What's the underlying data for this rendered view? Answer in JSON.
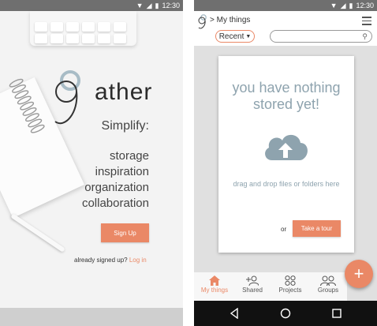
{
  "status_bar": {
    "time": "12:30"
  },
  "splash": {
    "logo_text": "ather",
    "tagline": "Simplify:",
    "features": [
      "storage",
      "inspiration",
      "organization",
      "collaboration"
    ],
    "signup_label": "Sign Up",
    "already_text": "already signed up?",
    "login_label": "Log in"
  },
  "home": {
    "breadcrumb": "> My things",
    "filter_label": "Recent",
    "search_placeholder": "",
    "empty_message": "you have nothing stored yet!",
    "drag_hint": "drag and drop files or folders here",
    "or_text": "or",
    "tour_label": "Take a tour",
    "fab_label": "+",
    "nav": [
      {
        "label": "My things",
        "icon": "home-icon",
        "active": true
      },
      {
        "label": "Shared",
        "icon": "add-person-icon",
        "active": false
      },
      {
        "label": "Projects",
        "icon": "grid-circles-icon",
        "active": false
      },
      {
        "label": "Groups",
        "icon": "group-icon",
        "active": false
      }
    ]
  },
  "colors": {
    "accent": "#ea8866",
    "muted_text": "#8ea3ae",
    "status_bar": "#6f6f6f"
  }
}
